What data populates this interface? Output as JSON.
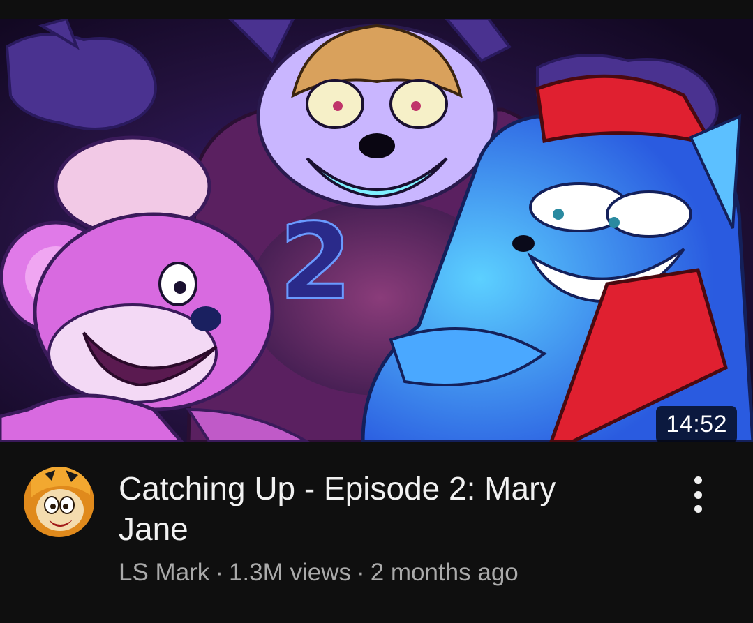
{
  "video": {
    "duration": "14:52",
    "title": "Catching Up - Episode 2: Mary Jane",
    "channel": "LS Mark",
    "views": "1.3M views",
    "age": "2 months ago",
    "separator": "·"
  },
  "thumbnail": {
    "overlay_text": "2"
  },
  "icons": {
    "menu": "more-vertical-icon"
  },
  "colors": {
    "background": "#0f0f0f",
    "title": "#f1f1f1",
    "secondary_text": "#aaaaaa",
    "duration_badge": "rgba(0,0,0,0.72)"
  }
}
